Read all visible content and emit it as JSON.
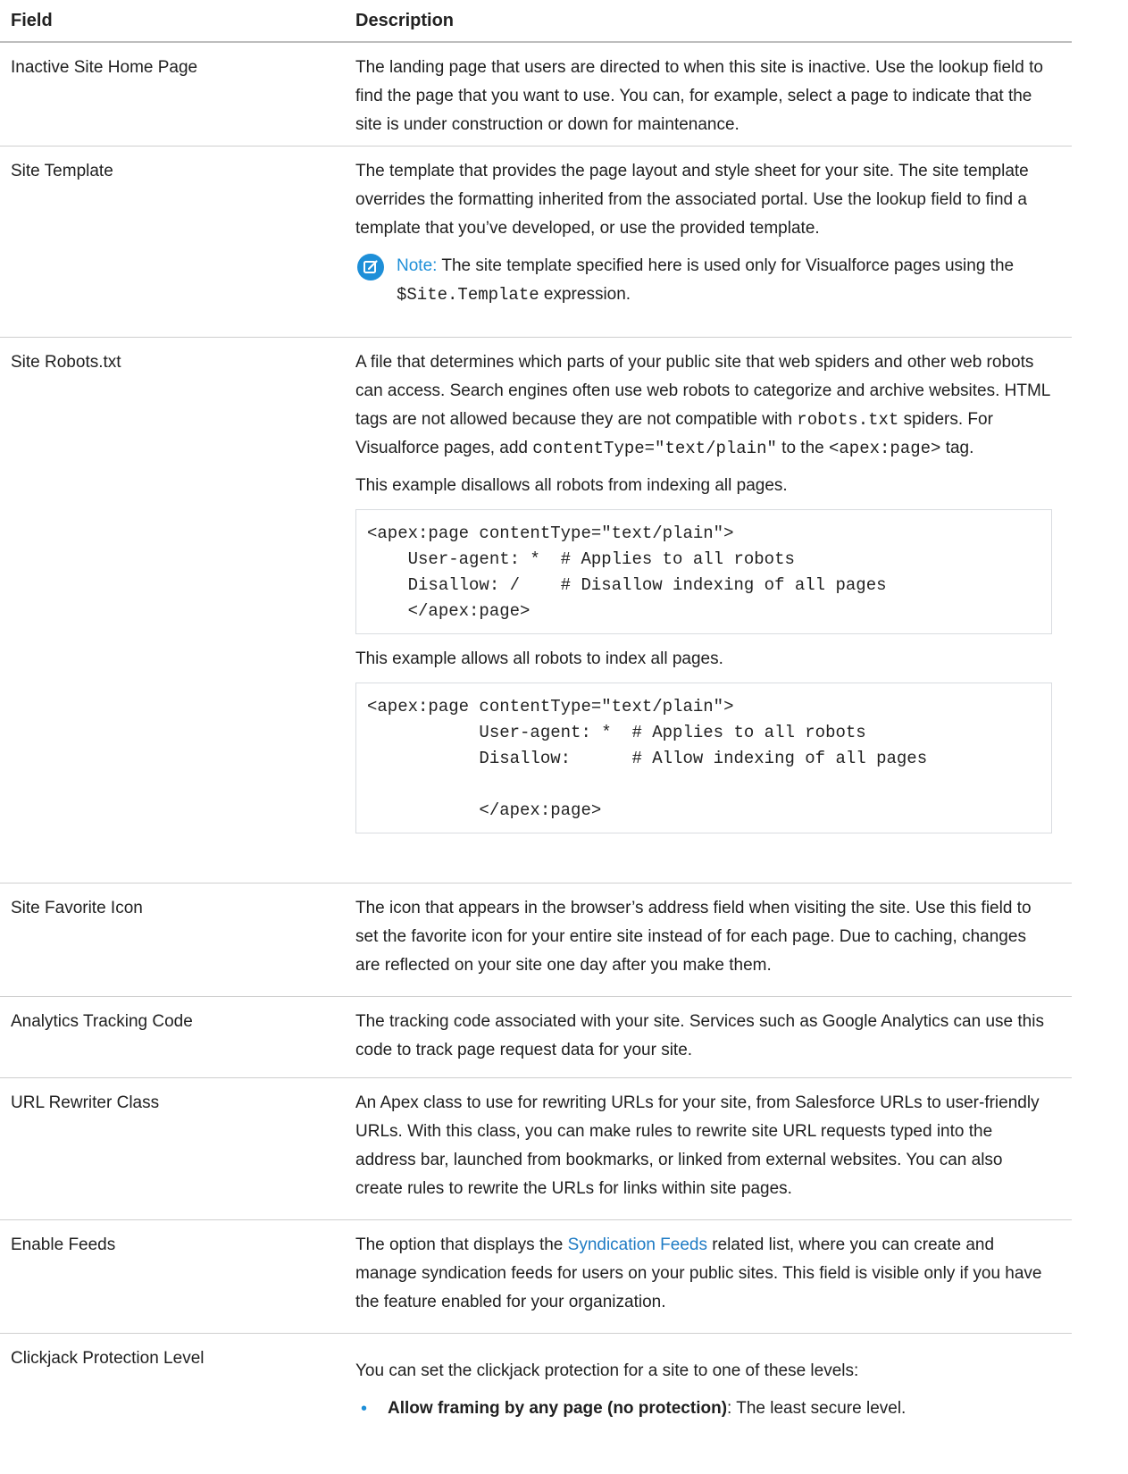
{
  "header": {
    "field": "Field",
    "description": "Description"
  },
  "rows": [
    {
      "field": "Inactive Site Home Page",
      "desc": "The landing page that users are directed to when this site is inactive. Use the lookup field to find the page that you want to use. You can, for example, select a page to indicate that the site is under construction or down for maintenance."
    },
    {
      "field": "Site Template",
      "desc": "The template that provides the page layout and style sheet for your site. The site template overrides the formatting inherited from the associated portal. Use the lookup field to find a template that you’ve developed, or use the provided template.",
      "note": {
        "label": "Note:",
        "text_before": " The site template specified here is used only for Visualforce pages using the ",
        "code": "$Site.Template",
        "text_after": " expression.",
        "icon": "edit-note-icon"
      }
    },
    {
      "field": "Site Robots.txt",
      "desc_1": "A file that determines which parts of your public site that web spiders and other web robots can access. Search engines often use web robots to categorize and archive websites. HTML tags are not allowed because they are not compatible with ",
      "code_1": "robots.txt",
      "desc_2": " spiders. For Visualforce pages, add ",
      "code_2": "contentType=\"text/plain\"",
      "desc_3": " to the ",
      "code_3": "<apex:page>",
      "desc_4": " tag.",
      "example1_intro": "This example disallows all robots from indexing all pages.",
      "example1_code": "<apex:page contentType=\"text/plain\">\n    User-agent: *  # Applies to all robots\n    Disallow: /    # Disallow indexing of all pages\n    </apex:page>",
      "example2_intro": "This example allows all robots to index all pages.",
      "example2_code": "<apex:page contentType=\"text/plain\">\n           User-agent: *  # Applies to all robots\n           Disallow:      # Allow indexing of all pages\n\n           </apex:page>"
    },
    {
      "field": "Site Favorite Icon",
      "desc": "The icon that appears in the browser’s address field when visiting the site. Use this field to set the favorite icon for your entire site instead of for each page. Due to caching, changes are reflected on your site one day after you make them."
    },
    {
      "field": "Analytics Tracking Code",
      "desc": "The tracking code associated with your site. Services such as Google Analytics can use this code to track page request data for your site."
    },
    {
      "field": "URL Rewriter Class",
      "desc": "An Apex class to use for rewriting URLs for your site, from Salesforce URLs to user-friendly URLs. With this class, you can make rules to rewrite site URL requests typed into the address bar, launched from bookmarks, or linked from external websites. You can also create rules to rewrite the URLs for links within site pages."
    },
    {
      "field": "Enable Feeds",
      "desc_before": "The option that displays the ",
      "link": "Syndication Feeds",
      "desc_after": " related list, where you can create and manage syndication feeds for users on your public sites. This field is visible only if you have the feature enabled for your organization."
    },
    {
      "field": "Clickjack Protection Level",
      "desc": "You can set the clickjack protection for a site to one of these levels:",
      "levels": [
        {
          "bold": "Allow framing by any page (no protection)",
          "rest": ": The least secure level."
        }
      ]
    }
  ],
  "colors": {
    "accent": "#1e8fd8",
    "link": "#1e7bc4",
    "rule": "#cfcfcf"
  }
}
